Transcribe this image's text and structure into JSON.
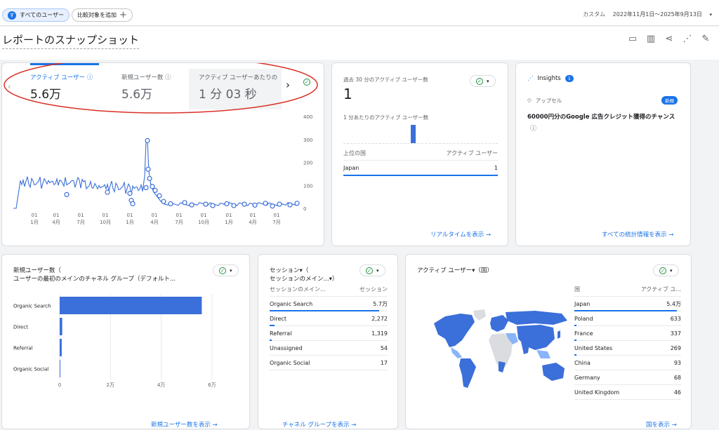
{
  "topbar": {
    "segment_label": "すべてのユーザー",
    "avatar_letter": "す",
    "compare_label": "比較対象を追加",
    "date_label": "カスタム",
    "date_value": "2022年11月1日～2025年9月13日"
  },
  "page": {
    "title": "レポートのスナップショット"
  },
  "overview": {
    "metrics": [
      {
        "label": "アクティブ ユーザー",
        "value": "5.6万"
      },
      {
        "label": "新規ユーザー数",
        "value": "5.6万"
      },
      {
        "label": "アクティブ ユーザーあたりの",
        "value": "1 分 03 秒"
      }
    ],
    "y_ticks": [
      "400",
      "300",
      "200",
      "100",
      "0"
    ],
    "x_ticks": [
      [
        "01",
        "1月"
      ],
      [
        "01",
        "4月"
      ],
      [
        "01",
        "7月"
      ],
      [
        "01",
        "10月"
      ],
      [
        "01",
        "1月"
      ],
      [
        "01",
        "4月"
      ],
      [
        "01",
        "7月"
      ],
      [
        "01",
        "10月"
      ],
      [
        "01",
        "1月"
      ],
      [
        "01",
        "4月"
      ],
      [
        "01",
        "7月"
      ]
    ]
  },
  "realtime": {
    "label_30min": "過去 30 分のアクティブ ユーザー数",
    "value_30min": "1",
    "label_permin": "1 分あたりのアクティブ ユーザー数",
    "col_country": "上位の国",
    "col_users": "アクティブ ユーザー",
    "rows": [
      {
        "country": "Japan",
        "users": "1"
      }
    ],
    "link": "リアルタイムを表示 →"
  },
  "insights": {
    "title": "Insights",
    "badge": "1",
    "tag_label": "アップセル",
    "new_badge": "新規",
    "text": "60000円分のGoogle 広告クレジット獲得のチャンス",
    "link": "すべての統計情報を表示 →"
  },
  "new_users": {
    "title_line1": "新規ユーザー数（",
    "title_line2": "ユーザーの最初のメインのチャネル グループ（デフォルト...",
    "footer": "新規ユーザー数を表示 →",
    "chart_data": {
      "type": "bar",
      "orientation": "horizontal",
      "categories": [
        "Organic Search",
        "Direct",
        "Referral",
        "Organic Social"
      ],
      "values": [
        56000,
        1000,
        800,
        100
      ],
      "xlim": [
        0,
        70000
      ],
      "x_ticks": [
        "0",
        "2万",
        "4万",
        "6万"
      ],
      "bar_color": "#3b6fd9"
    }
  },
  "sessions": {
    "title_line1": "セッション▾（",
    "title_line2": "セッションのメイン...▾）",
    "col_channel": "セッションのメイン...",
    "col_sessions": "セッション",
    "rows": [
      {
        "channel": "Organic Search",
        "value": "5.7万",
        "share": 0.93
      },
      {
        "channel": "Direct",
        "value": "2,272",
        "share": 0.04
      },
      {
        "channel": "Referral",
        "value": "1,319",
        "share": 0.02
      },
      {
        "channel": "Unassigned",
        "value": "54",
        "share": 0.0
      },
      {
        "channel": "Organic Social",
        "value": "17",
        "share": 0.0
      }
    ],
    "footer": "チャネル グループを表示 →"
  },
  "countries": {
    "title": "アクティブ ユーザー▾（国）",
    "col_country": "国",
    "col_users": "アクティブ ユ...",
    "rows": [
      {
        "country": "Japan",
        "value": "5.4万",
        "share": 0.96
      },
      {
        "country": "Poland",
        "value": "633",
        "share": 0.02
      },
      {
        "country": "France",
        "value": "337",
        "share": 0.01
      },
      {
        "country": "United States",
        "value": "269",
        "share": 0.01
      },
      {
        "country": "China",
        "value": "93",
        "share": 0.0
      },
      {
        "country": "Germany",
        "value": "68",
        "share": 0.0
      },
      {
        "country": "United Kingdom",
        "value": "46",
        "share": 0.0
      }
    ],
    "footer": "国を表示 →"
  },
  "colors": {
    "accent": "#1a73e8",
    "bar": "#3b6fd9",
    "annotation": "#d93025",
    "check": "#1e8e3e"
  }
}
